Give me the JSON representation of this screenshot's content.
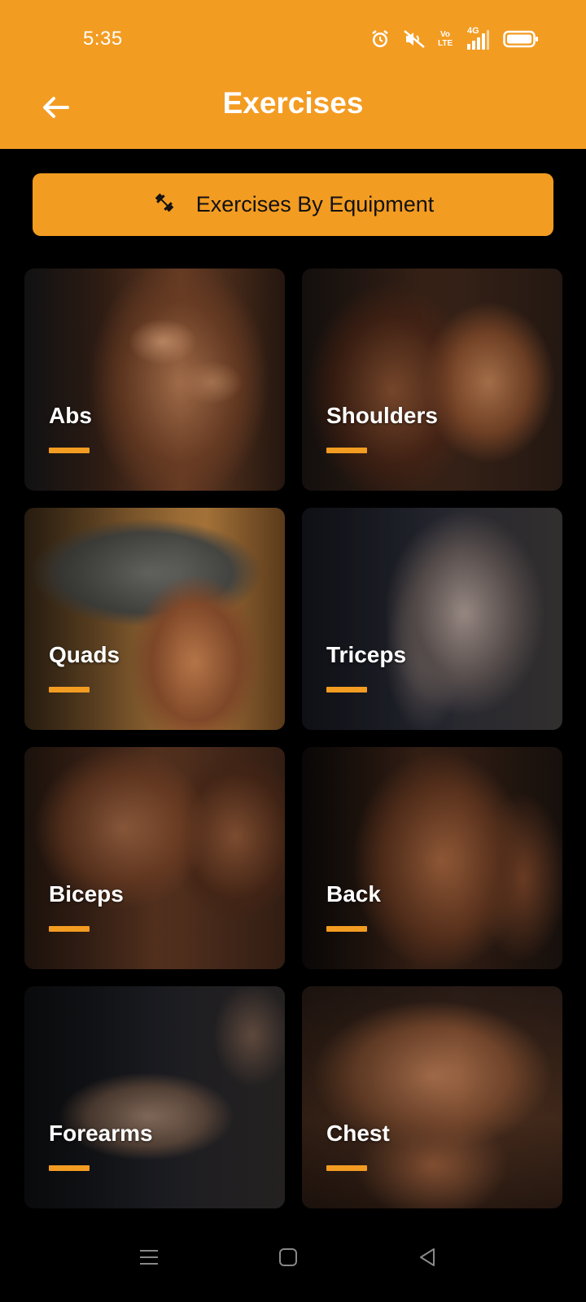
{
  "status_bar": {
    "time": "5:35",
    "icons": [
      "alarm-icon",
      "mute-icon",
      "volte-icon",
      "signal-4g-icon",
      "battery-icon"
    ],
    "volte_text": "Vo LTE",
    "network_text": "4G"
  },
  "app_bar": {
    "title": "Exercises",
    "back_icon": "back-arrow-icon"
  },
  "equipment_button": {
    "label": "Exercises By Equipment",
    "icon": "dumbbell-icon"
  },
  "categories": [
    {
      "label": "Abs"
    },
    {
      "label": "Shoulders"
    },
    {
      "label": "Quads"
    },
    {
      "label": "Triceps"
    },
    {
      "label": "Biceps"
    },
    {
      "label": "Back"
    },
    {
      "label": "Forearms"
    },
    {
      "label": "Chest"
    }
  ],
  "nav_bar": {
    "icons": [
      "menu-icon",
      "home-icon",
      "back-triangle-icon"
    ]
  },
  "colors": {
    "accent": "#F39C22",
    "background": "#000000",
    "text": "#FFFFFF",
    "button_text": "#111111"
  }
}
